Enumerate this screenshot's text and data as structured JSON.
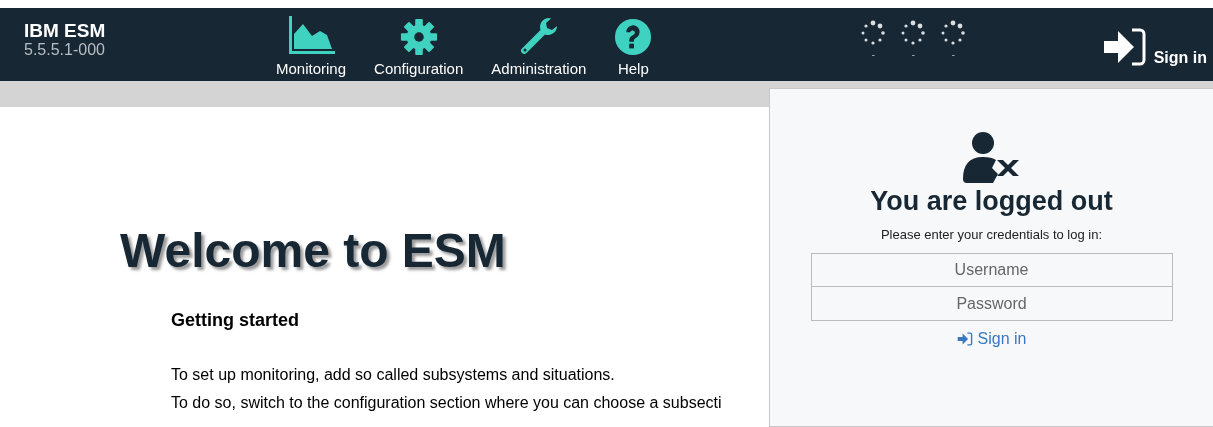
{
  "brand": {
    "title": "IBM ESM",
    "version": "5.5.5.1-000"
  },
  "nav": [
    {
      "label": "Monitoring",
      "kind": "chart"
    },
    {
      "label": "Configuration",
      "kind": "gear"
    },
    {
      "label": "Administration",
      "kind": "wrench"
    },
    {
      "label": "Help",
      "kind": "help"
    }
  ],
  "indicators": [
    {
      "label": "-"
    },
    {
      "label": "-"
    },
    {
      "label": "-"
    }
  ],
  "sign_in_button": "Sign in",
  "main": {
    "heading": "Welcome to ESM",
    "subheading": "Getting started",
    "paragraphs": [
      "To set up monitoring, add so called subsystems and situations.",
      "To do so, switch to the configuration section where you can choose a subsecti"
    ]
  },
  "login_popup": {
    "title": "You are logged out",
    "prompt": "Please enter your credentials to log in:",
    "username_placeholder": "Username",
    "password_placeholder": "Password",
    "submit": "Sign in"
  }
}
